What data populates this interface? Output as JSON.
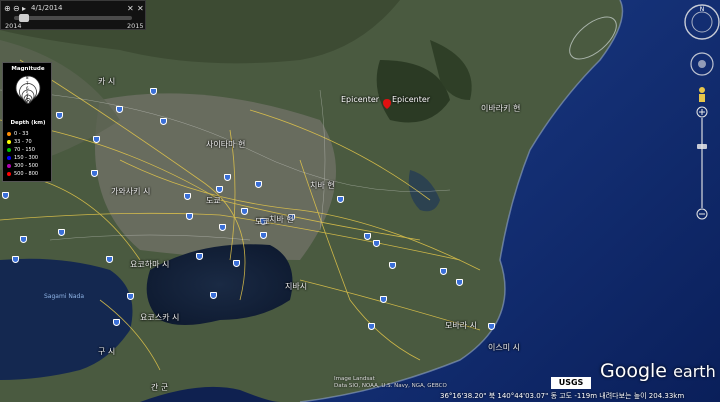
{
  "time_slider": {
    "date_label": "4/1/2014",
    "start_year": "2014",
    "end_year": "2015",
    "position": 0.05
  },
  "legend": {
    "title": "Magnitude",
    "depth_title": "Depth (km)",
    "magnitude_values": [
      "8",
      "7",
      "6",
      "5",
      "4",
      "3"
    ],
    "depth_ranges": [
      {
        "label": "0 - 33",
        "color": "#ff8c00"
      },
      {
        "label": "33 - 70",
        "color": "#ffff00"
      },
      {
        "label": "70 - 150",
        "color": "#00c000"
      },
      {
        "label": "150 - 300",
        "color": "#0000ff"
      },
      {
        "label": "300 - 500",
        "color": "#b000b0"
      },
      {
        "label": "500 - 800",
        "color": "#ff0000"
      }
    ]
  },
  "epicenter": {
    "label_left": "Epicenter",
    "label_right": "Epicenter",
    "color": "#e01010"
  },
  "places": [
    {
      "name": "사이타마 현"
    },
    {
      "name": "이바라키 현"
    },
    {
      "name": "도쿄"
    },
    {
      "name": "치바 현"
    },
    {
      "name": "지바시"
    },
    {
      "name": "가와사키 시"
    },
    {
      "name": "요코스카 시"
    },
    {
      "name": "요코하마 시"
    },
    {
      "name": "도쿄"
    },
    {
      "name": "카 시"
    },
    {
      "name": "치바 현"
    },
    {
      "name": "모바라 시"
    },
    {
      "name": "이스미 시"
    },
    {
      "name": "간 군"
    },
    {
      "name": "구 시"
    }
  ],
  "seas": [
    "Sagami Nada"
  ],
  "attribution": {
    "usgs": "USGS",
    "credit": "Image Landsat\nData SIO, NOAA, U.S. Navy, NGA, GEBCO"
  },
  "status_bar": "36°16'38.20\" 북  140°44'03.07\" 동  고도  -119m  내려다보는 높이  204.33km",
  "logo": {
    "google": "Google",
    "earth": "earth"
  }
}
